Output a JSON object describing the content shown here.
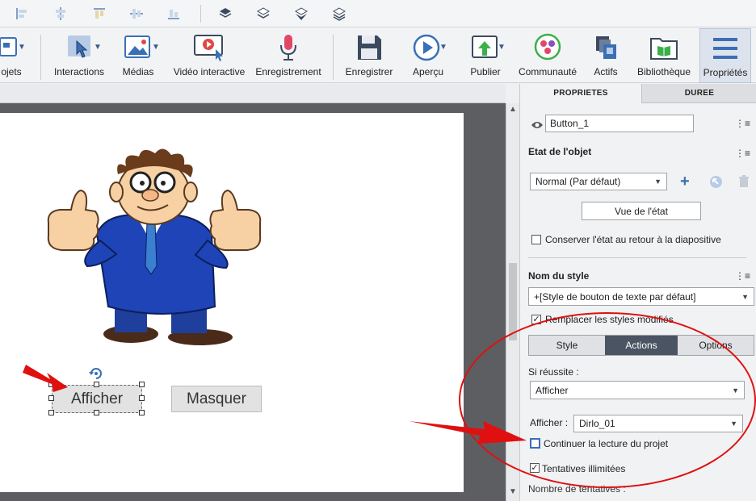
{
  "toolbar": {
    "items": [
      {
        "label": "ojets",
        "icon": "objects-icon"
      },
      {
        "label": "Interactions",
        "icon": "interactions-icon"
      },
      {
        "label": "Médias",
        "icon": "media-icon"
      },
      {
        "label": "Vidéo interactive",
        "icon": "interactive-video-icon"
      },
      {
        "label": "Enregistrement",
        "icon": "microphone-icon"
      },
      {
        "label": "Enregistrer",
        "icon": "save-icon"
      },
      {
        "label": "Aperçu",
        "icon": "preview-icon"
      },
      {
        "label": "Publier",
        "icon": "publish-icon"
      },
      {
        "label": "Communauté",
        "icon": "community-icon"
      },
      {
        "label": "Actifs",
        "icon": "assets-icon"
      },
      {
        "label": "Bibliothèque",
        "icon": "library-icon"
      },
      {
        "label": "Propriétés",
        "icon": "properties-icon"
      }
    ]
  },
  "stage": {
    "button_afficher": "Afficher",
    "button_masquer": "Masquer"
  },
  "panel": {
    "tabs": {
      "properties": "PROPRIETES",
      "duration": "DUREE"
    },
    "object_name": "Button_1",
    "object_state_heading": "Etat de l'objet",
    "state_select": "Normal (Par défaut)",
    "state_view_button": "Vue de l'état",
    "keep_state_label": "Conserver l'état au retour à la diapositive",
    "style_name_heading": "Nom du style",
    "style_select": "+[Style de bouton de texte par défaut]",
    "replace_styles_label": "Remplacer les styles modifiés",
    "subtabs": {
      "style": "Style",
      "actions": "Actions",
      "options": "Options"
    },
    "on_success_label": "Si réussite :",
    "on_success_select": "Afficher",
    "show_label": "Afficher :",
    "show_select": "Dirlo_01",
    "continue_label": "Continuer la lecture du projet",
    "unlimited_label": "Tentatives illimitées",
    "attempts_label": "Nombre de tentatives :"
  },
  "colors": {
    "accent": "#3a6fb5",
    "annotation_red": "#e01010",
    "active_subtab": "#4a5463"
  }
}
